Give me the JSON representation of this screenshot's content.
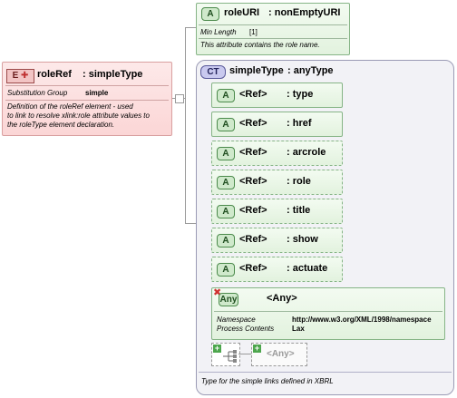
{
  "element": {
    "badge": "E",
    "name": "roleRef",
    "type": ": simpleType",
    "prop_label": "Substitution Group",
    "prop_value": "simple",
    "doc": [
      "Definition of the roleRef element - used",
      "to link to resolve xlink:role attribute values to",
      "the roleType element declaration."
    ]
  },
  "roleuri": {
    "badge": "A",
    "name": "roleURI",
    "type": ": nonEmptyURI",
    "prop_label": "Min Length",
    "prop_value": "[1]",
    "doc": "This attribute contains the role name."
  },
  "complex_type": {
    "badge": "CT",
    "name": "simpleType",
    "type": ": anyType",
    "doc": "Type for the simple links defined in XBRL"
  },
  "refs": [
    {
      "badge": "A",
      "ref": "<Ref>",
      "name": ": type",
      "optional": false
    },
    {
      "badge": "A",
      "ref": "<Ref>",
      "name": ": href",
      "optional": false
    },
    {
      "badge": "A",
      "ref": "<Ref>",
      "name": ": arcrole",
      "optional": true
    },
    {
      "badge": "A",
      "ref": "<Ref>",
      "name": ": role",
      "optional": true
    },
    {
      "badge": "A",
      "ref": "<Ref>",
      "name": ": title",
      "optional": true
    },
    {
      "badge": "A",
      "ref": "<Ref>",
      "name": ": show",
      "optional": true
    },
    {
      "badge": "A",
      "ref": "<Ref>",
      "name": ": actuate",
      "optional": true
    }
  ],
  "any_attr": {
    "badge": "Any",
    "name": "<Any>",
    "ns_label": "Namespace",
    "ns_value": "http://www.w3.org/XML/1998/namespace",
    "pc_label": "Process Contents",
    "pc_value": "Lax"
  },
  "any_elem": {
    "label": "<Any>"
  }
}
